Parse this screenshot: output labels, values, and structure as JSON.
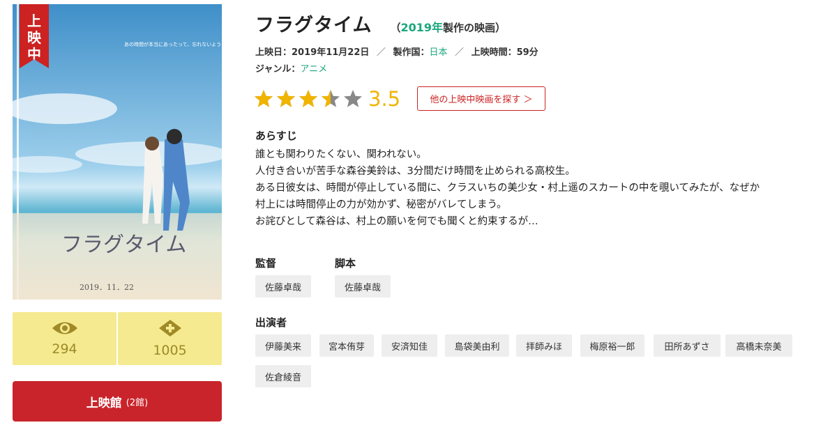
{
  "poster": {
    "ribbon": [
      "上",
      "映",
      "中"
    ],
    "poster_title": "フラグタイム",
    "poster_date": "2019．11．22",
    "poster_tagline": "あの時間が本当にあったって、忘れないように。"
  },
  "stats": {
    "views": "294",
    "clips": "1005",
    "colors": {
      "bg": "#f5ea8f",
      "num": "#9b8a2a",
      "icon": "#a08a28"
    }
  },
  "theater_button": {
    "label": "上映館",
    "count": "(2館)",
    "color": "#c9242b"
  },
  "movie": {
    "title": "フラグタイム",
    "sub_open": "（",
    "year": "2019年",
    "sub_rest": "製作の映画）",
    "release_label": "上映日：",
    "release_value": "2019年11月22日",
    "slash1": "／",
    "country_label": "製作国：",
    "country_value": "日本",
    "slash2": "／",
    "runtime_label": "上映時間：",
    "runtime_value": "59分",
    "genre_label": "ジャンル：",
    "genre_value": "アニメ"
  },
  "rating": {
    "score": "3.5",
    "value": 3.5,
    "max": 5,
    "star_color": "#f0b400",
    "empty_color": "#888888",
    "search_button": "他の上映中映画を探す ＞"
  },
  "synopsis": {
    "heading": "あらすじ",
    "lines": [
      "誰とも関わりたくない、関われない。",
      "人付き合いが苦手な森谷美鈴は、3分間だけ時間を止められる高校生。",
      "ある日彼女は、時間が停止している間に、クラスいちの美少女・村上遥のスカートの中を覗いてみたが、なぜか",
      "村上には時間停止の力が効かず、秘密がバレてしまう。",
      "お詫びとして森谷は、村上の願いを何でも聞くと約束するが…"
    ]
  },
  "staff": {
    "director_heading": "監督",
    "director": "佐藤卓哉",
    "writer_heading": "脚本",
    "writer": "佐藤卓哉"
  },
  "cast": {
    "heading": "出演者",
    "members": [
      "伊藤美来",
      "宮本侑芽",
      "安済知佳",
      "島袋美由利",
      "拝師みほ",
      "梅原裕一郎",
      "田所あずさ",
      "高橋未奈美",
      "佐倉綾音"
    ]
  },
  "accent": {
    "red": "#cc2222",
    "green": "#1aa77e"
  }
}
